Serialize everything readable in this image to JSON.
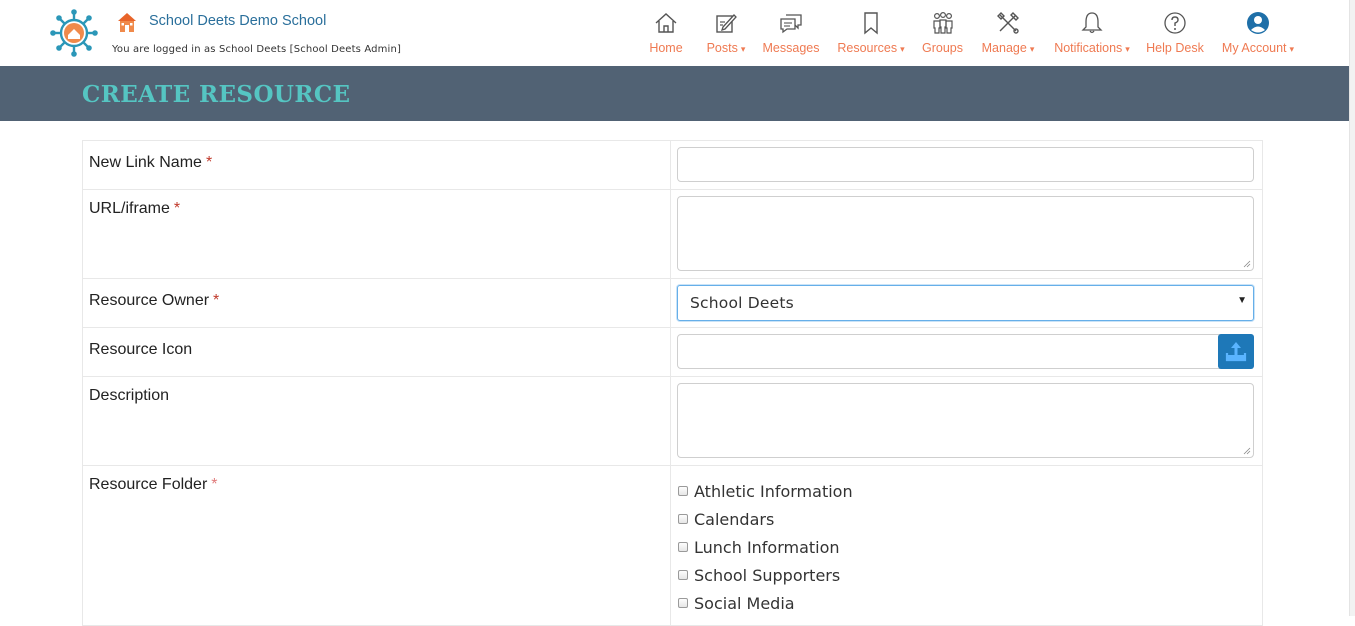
{
  "header": {
    "school_name": "School Deets Demo School",
    "logged_in_text": "You are logged in as School Deets [School Deets Admin]"
  },
  "nav": {
    "home": "Home",
    "posts": "Posts",
    "messages": "Messages",
    "resources": "Resources",
    "groups": "Groups",
    "manage": "Manage",
    "notifications": "Notifications",
    "help_desk": "Help Desk",
    "my_account": "My Account",
    "caret": "▾"
  },
  "page": {
    "title": "CREATE RESOURCE"
  },
  "form": {
    "new_link_name_label": "New Link Name",
    "new_link_name_value": "",
    "url_label": "URL/iframe",
    "url_value": "",
    "owner_label": "Resource Owner",
    "owner_value": "School Deets",
    "icon_label": "Resource Icon",
    "description_label": "Description",
    "folder_label": "Resource Folder",
    "required_mark": "*",
    "folders": [
      "Athletic Information",
      "Calendars",
      "Lunch Information",
      "School Supporters",
      "Social Media"
    ]
  },
  "colors": {
    "nav_text": "#ef7a52",
    "title_bar": "#516274",
    "title_text": "#55c5c2",
    "school_name": "#2a6f9b",
    "upload_button": "#1e78b8",
    "required": "#c0392b"
  }
}
